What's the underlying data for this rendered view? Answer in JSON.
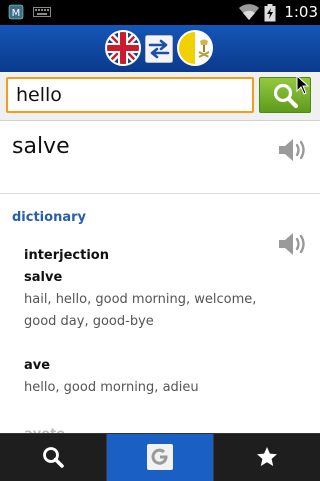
{
  "status_bar": {
    "time": "1:03",
    "icons": [
      "app-notification-icon",
      "keyboard-icon",
      "wifi-icon",
      "battery-charging-icon"
    ]
  },
  "header": {
    "source_language": "English",
    "target_language": "Latin",
    "source_flag": "uk-flag-icon",
    "target_flag": "vatican-flag-icon",
    "swap_icon": "swap-arrows-icon"
  },
  "search": {
    "value": "hello",
    "button_icon": "search-icon"
  },
  "result": {
    "main_translation": "salve"
  },
  "dictionary": {
    "title": "dictionary",
    "part_of_speech": "interjection",
    "entries": [
      {
        "word": "salve",
        "meanings": "hail, hello, good morning, welcome, good day, good-bye"
      },
      {
        "word": "ave",
        "meanings": "hello, good morning, adieu"
      }
    ],
    "partial_next_word": "avete"
  },
  "bottom_tabs": [
    {
      "name": "search",
      "icon": "search-icon",
      "active": false
    },
    {
      "name": "google",
      "icon": "google-icon",
      "active": true
    },
    {
      "name": "favorites",
      "icon": "star-icon",
      "active": false
    }
  ],
  "colors": {
    "header_blue": "#1456b8",
    "search_border": "#f39c1e",
    "search_button": "#7ab52e",
    "section_title": "#2a5ea8",
    "active_tab": "#1a5fc4",
    "bottom_bar": "#1e1e1e"
  }
}
